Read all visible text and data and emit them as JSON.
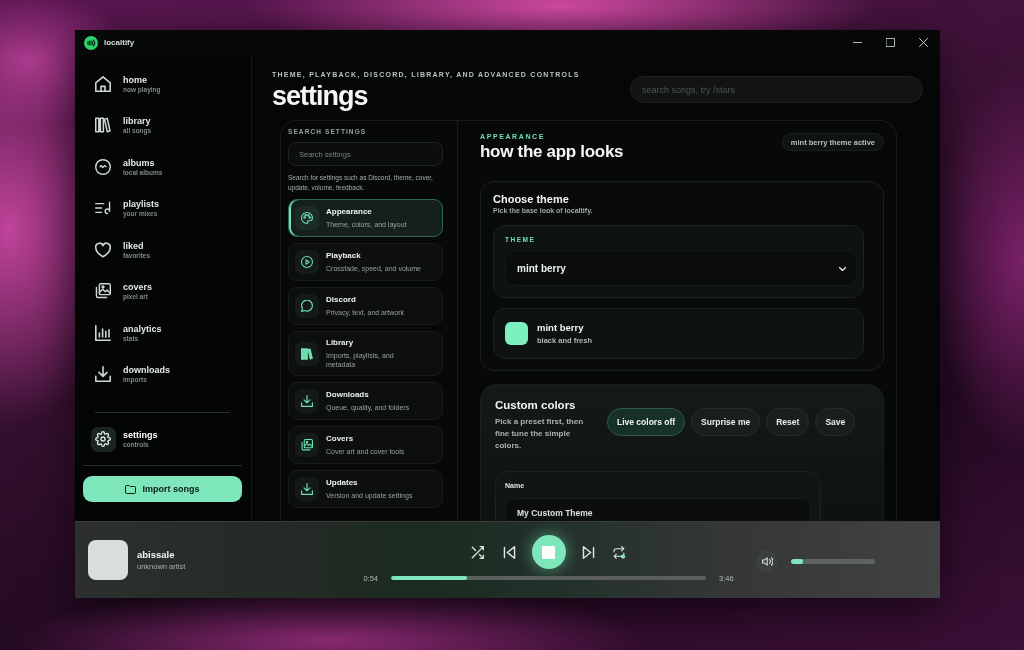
{
  "window": {
    "title": "localtify"
  },
  "sidebar": {
    "items": [
      {
        "label": "home",
        "sublabel": "now playing",
        "selected": false
      },
      {
        "label": "library",
        "sublabel": "all songs",
        "selected": false
      },
      {
        "label": "albums",
        "sublabel": "local albums",
        "selected": false
      },
      {
        "label": "playlists",
        "sublabel": "your mixes",
        "selected": false
      },
      {
        "label": "liked",
        "sublabel": "favorites",
        "selected": false
      },
      {
        "label": "covers",
        "sublabel": "pixel art",
        "selected": false
      },
      {
        "label": "analytics",
        "sublabel": "stats",
        "selected": false
      },
      {
        "label": "downloads",
        "sublabel": "imports",
        "selected": false
      }
    ],
    "settings_item": {
      "label": "settings",
      "sublabel": "controls",
      "selected": true
    },
    "import_button": {
      "label": "Import songs"
    }
  },
  "header": {
    "eyebrow": "THEME, PLAYBACK, DISCORD, LIBRARY, AND ADVANCED CONTROLS",
    "title": "settings",
    "search": {
      "placeholder": "search songs, try /stars"
    }
  },
  "settings_nav": {
    "label": "SEARCH SETTINGS",
    "search": {
      "placeholder": "Search settings"
    },
    "hint": "Search for settings such as Discord, theme, cover, update, volume, feedback.",
    "items": [
      {
        "title": "Appearance",
        "description": "Theme, colors, and layout",
        "selected": true
      },
      {
        "title": "Playback",
        "description": "Crossfade, speed, and volume",
        "selected": false
      },
      {
        "title": "Discord",
        "description": "Privacy, text, and artwork",
        "selected": false
      },
      {
        "title": "Library",
        "description": "Imports, playlists, and metadata",
        "selected": false
      },
      {
        "title": "Downloads",
        "description": "Queue, quality, and folders",
        "selected": false
      },
      {
        "title": "Covers",
        "description": "Cover art and cover tools",
        "selected": false
      },
      {
        "title": "Updates",
        "description": "Version and update settings",
        "selected": false
      }
    ]
  },
  "appearance": {
    "eyebrow": "APPEARANCE",
    "title": "how the app looks",
    "badge": "mint berry theme active",
    "theme_card": {
      "title": "Choose theme",
      "subtitle": "Pick the base look of localtify.",
      "field_label": "THEME",
      "select_value": "mint berry",
      "preview": {
        "name": "mint berry",
        "description": "black and fresh",
        "color": "#7df0c2"
      }
    },
    "custom_colors": {
      "title": "Custom colors",
      "description": "Pick a preset first, then fine tune the simple colors.",
      "buttons": [
        {
          "label": "Live colors off",
          "kind": "toggle"
        },
        {
          "label": "Surprise me",
          "kind": "action"
        },
        {
          "label": "Reset",
          "kind": "action"
        },
        {
          "label": "Save",
          "kind": "action"
        }
      ],
      "name_field": {
        "label": "Name",
        "value": "My Custom Theme"
      }
    }
  },
  "player": {
    "title": "abissale",
    "artist": "unknown artist",
    "elapsed": "0:54",
    "duration": "3:46",
    "progress": {
      "level": 0.24
    },
    "volume": {
      "level": 0.14
    }
  }
}
